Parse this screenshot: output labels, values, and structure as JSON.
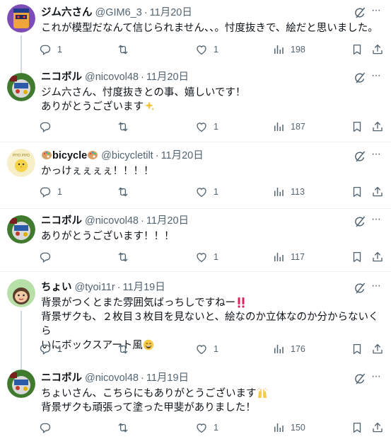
{
  "tweets": [
    {
      "name": "ジム六さん",
      "handle": "@GIM6_3",
      "dot": "·",
      "date": "11月20日",
      "text": "これが模型だなんて信じられません、、。忖度抜きで、絵だと思いました。",
      "replies": "1",
      "retweets": "",
      "likes": "1",
      "views": "198"
    },
    {
      "name": "ニコボル",
      "handle": "@nicovol48",
      "dot": "·",
      "date": "11月20日",
      "text": "ジム六さん、忖度抜きとの事、嬉しいです！\nありがとうございます",
      "replies": "",
      "retweets": "",
      "likes": "1",
      "views": "187"
    },
    {
      "name": "bicycle",
      "handle": "@bicycletilt",
      "dot": "·",
      "date": "11月20日",
      "text": "かっけぇぇぇぇ！！！！",
      "replies": "1",
      "retweets": "",
      "likes": "1",
      "views": "113",
      "avatar_text": "PIYO PIYO"
    },
    {
      "name": "ニコボル",
      "handle": "@nicovol48",
      "dot": "·",
      "date": "11月20日",
      "text": "ありがとうございます！！！",
      "replies": "",
      "retweets": "",
      "likes": "1",
      "views": "117"
    },
    {
      "name": "ちょい",
      "handle": "@tyoi11r",
      "dot": "·",
      "date": "11月19日",
      "text_line1": "背景がつくとまた雰囲気ばっちしですねー",
      "text_line2": "背景ザクも、２枚目３枚目を見ないと、絵なのか立体なのか分からないくら",
      "text_line3": "いにボックスアート風",
      "replies": "1",
      "retweets": "",
      "likes": "1",
      "views": "176"
    },
    {
      "name": "ニコボル",
      "handle": "@nicovol48",
      "dot": "·",
      "date": "11月19日",
      "text_line1": "ちょいさん、こちらにもありがとうございます",
      "text_line2": "背景ザクも頑張って塗った甲斐がありました！",
      "replies": "",
      "retweets": "",
      "likes": "1",
      "views": "150"
    }
  ],
  "colors": {
    "text": "#0f1419",
    "secondary": "#536471",
    "divider": "#eff3f4",
    "thread_line": "#cfd9de"
  },
  "icons": [
    "reply-icon",
    "retweet-icon",
    "like-icon",
    "views-icon",
    "bookmark-icon",
    "share-icon",
    "grok-icon",
    "more-icon"
  ]
}
